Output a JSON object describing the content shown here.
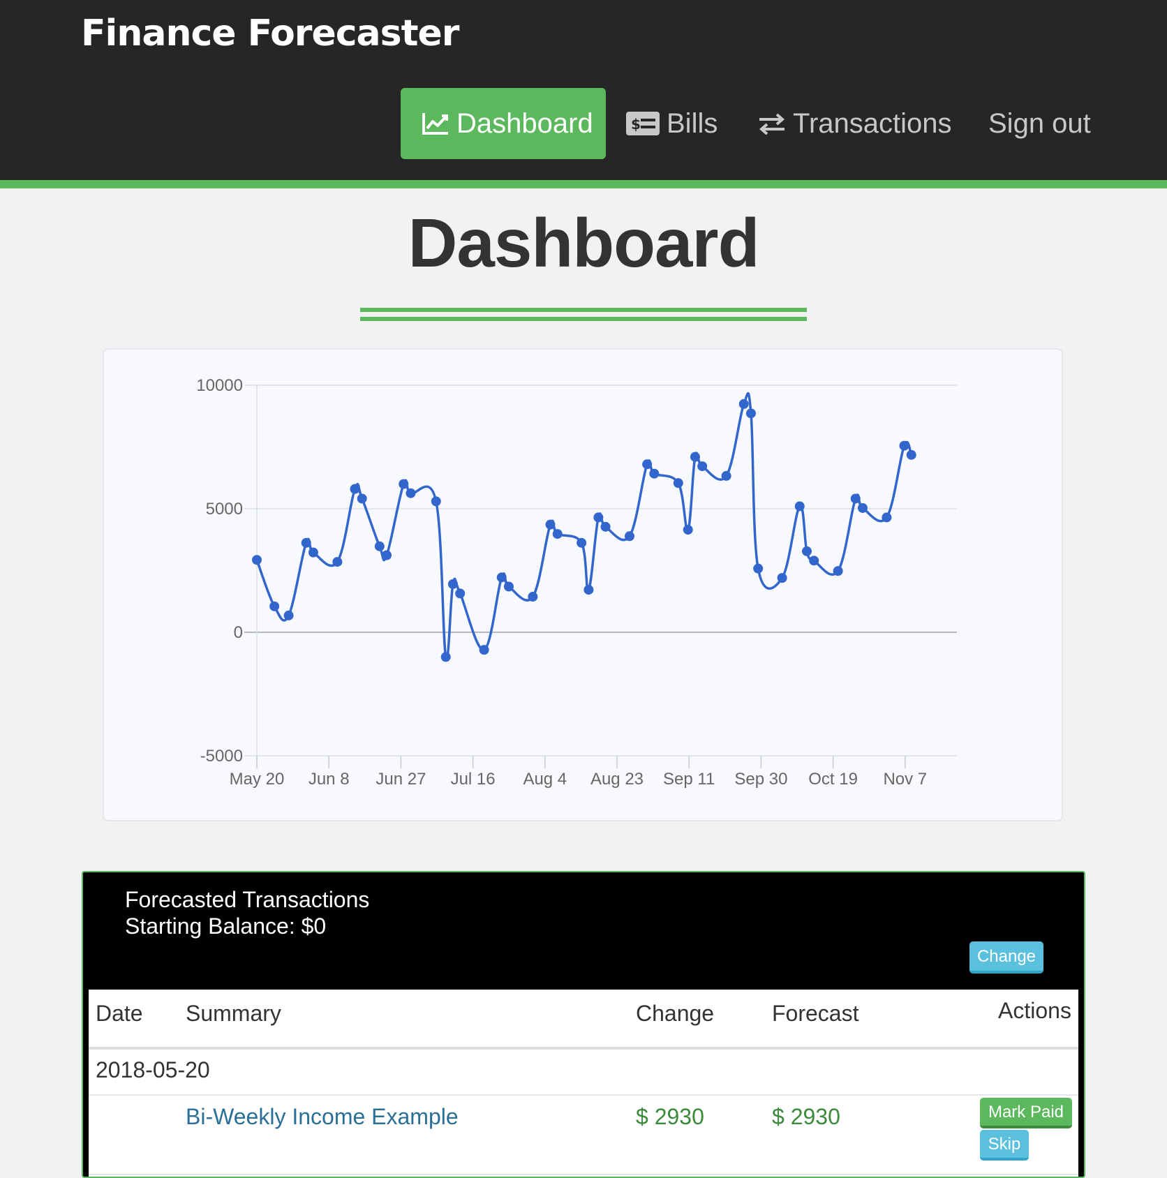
{
  "app": {
    "brand": "Finance Forecaster"
  },
  "nav": {
    "dashboard": "Dashboard",
    "bills": "Bills",
    "transactions": "Transactions",
    "sign_out": "Sign out"
  },
  "page": {
    "title": "Dashboard"
  },
  "chart_data": {
    "type": "line",
    "title": "",
    "xlabel": "",
    "ylabel": "",
    "ylim": [
      -5000,
      10000
    ],
    "y_ticks": [
      "10000",
      "5000",
      "0",
      "-5000"
    ],
    "x_ticks": [
      "May 20",
      "Jun 8",
      "Jun 27",
      "Jul 16",
      "Aug 4",
      "Aug 23",
      "Sep 11",
      "Sep 30",
      "Oct 19",
      "Nov 7"
    ],
    "grid": true,
    "color": "#3366cc",
    "series": [
      {
        "values": [
          2930,
          1050,
          680,
          3620,
          3230,
          2850,
          5800,
          5410,
          3480,
          3120,
          6000,
          5630,
          5300,
          -1000,
          1950,
          1570,
          -710,
          2220,
          1850,
          1440,
          4360,
          3980,
          3620,
          1720,
          4650,
          4270,
          3890,
          6800,
          6420,
          6040,
          4150,
          7100,
          6720,
          6330,
          9240,
          8860,
          2580,
          2200,
          5100,
          3280,
          2900,
          2480,
          5410,
          5030,
          4650,
          7550,
          7180
        ]
      }
    ]
  },
  "transactions_panel": {
    "title": "Forecasted Transactions",
    "starting_balance": "Starting Balance: $0",
    "change_button": "Change",
    "columns": {
      "date": "Date",
      "summary": "Summary",
      "change": "Change",
      "forecast": "Forecast",
      "actions": "Actions"
    },
    "groups": [
      {
        "date": "2018-05-20",
        "rows": [
          {
            "summary": "Bi-Weekly Income Example",
            "change": "$ 2930",
            "forecast": "$ 2930",
            "mark_paid": "Mark Paid",
            "skip": "Skip"
          }
        ]
      }
    ]
  }
}
